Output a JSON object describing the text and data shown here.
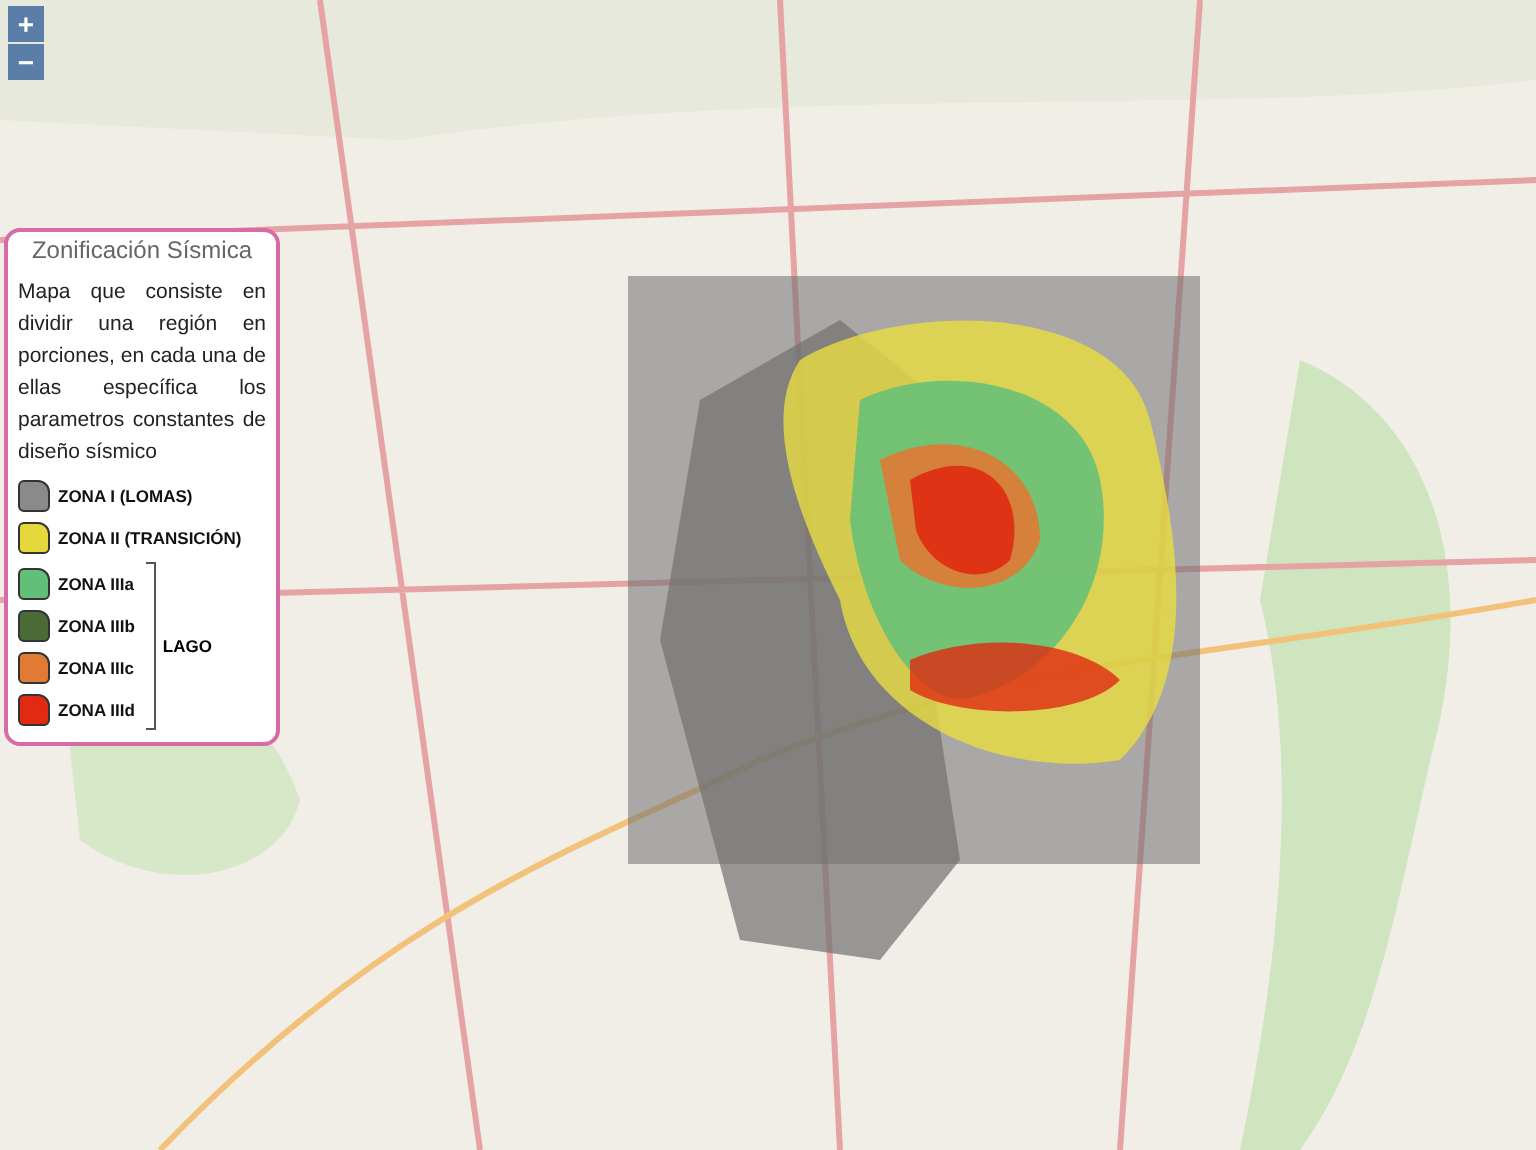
{
  "zoom_controls": [
    {
      "label": "+"
    },
    {
      "label": "−"
    }
  ],
  "legend": {
    "title": "Zonificación Sísmica",
    "description": "Mapa que consiste en dividir una región en porciones, en cada una de ellas específica los parametros constantes de diseño sísmico",
    "zones": [
      {
        "label": "ZONA I (LOMAS)",
        "color": "#8a8a8a"
      },
      {
        "label": "ZONA II (TRANSICIÓN)",
        "color": "#e6d83a"
      }
    ],
    "group": {
      "label": "LAGO",
      "zones": [
        {
          "label": "ZONA IIIa",
          "color": "#62bf7a"
        },
        {
          "label": "ZONA IIIb",
          "color": "#4b6b36"
        },
        {
          "label": "ZONA IIIc",
          "color": "#e07a35"
        },
        {
          "label": "ZONA IIId",
          "color": "#e02a12"
        }
      ]
    }
  }
}
